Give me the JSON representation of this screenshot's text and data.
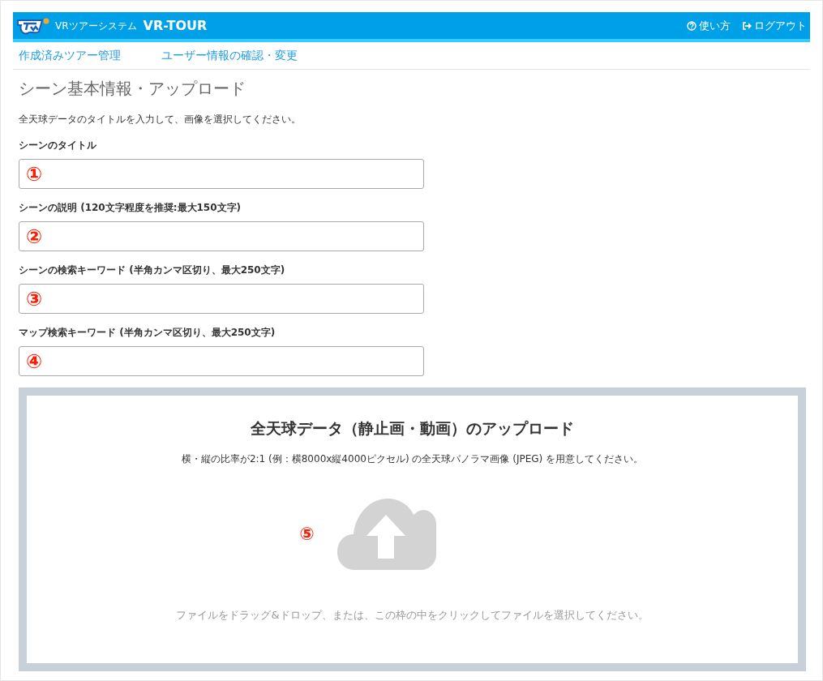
{
  "header": {
    "subtitle": "VRツアーシステム",
    "brand": "VR-TOUR",
    "links": [
      {
        "kind": "help",
        "label": "使い方"
      },
      {
        "kind": "logout",
        "label": "ログアウト"
      }
    ]
  },
  "nav": [
    "作成済みツアー管理",
    "ユーザー情報の確認・変更"
  ],
  "page_title": "シーン基本情報・アップロード",
  "intro": "全天球データのタイトルを入力して、画像を選択してください。",
  "fields": [
    {
      "label": "シーンのタイトル",
      "marker": "①"
    },
    {
      "label": "シーンの説明 (120文字程度を推奨:最大150文字)",
      "marker": "②"
    },
    {
      "label": "シーンの検索キーワード (半角カンマ区切り、最大250文字)",
      "marker": "③"
    },
    {
      "label": "マップ検索キーワード (半角カンマ区切り、最大250文字)",
      "marker": "④"
    }
  ],
  "upload": {
    "title": "全天球データ（静止画・動画）のアップロード",
    "note": "横・縦の比率が2:1 (例：横8000x縦4000ピクセル) の全天球パノラマ画像 (JPEG) を用意してください。",
    "marker": "⑤",
    "hint": "ファイルをドラッグ&ドロップ、または、この枠の中をクリックしてファイルを選択してください。"
  }
}
